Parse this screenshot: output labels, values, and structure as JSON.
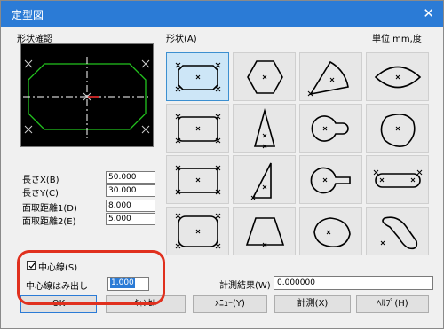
{
  "window": {
    "title": "定型図",
    "close_glyph": "✕"
  },
  "labels": {
    "preview": "形状確認",
    "shape": "形状(A)",
    "units": "単位 mm,度"
  },
  "fields": [
    {
      "label": "長さX(B)",
      "value": "50.000"
    },
    {
      "label": "長さY(C)",
      "value": "30.000"
    },
    {
      "label": "面取距離1(D)",
      "value": "8.000"
    },
    {
      "label": "面取距離2(E)",
      "value": "5.000"
    }
  ],
  "centerline": {
    "checkbox_label": "中心線(S)",
    "checked": true,
    "overhang_label": "中心線はみ出し",
    "overhang_value": "1.000"
  },
  "measure": {
    "label": "計測結果(W)",
    "value": "0.000000"
  },
  "buttons": {
    "ok": "OK",
    "cancel": "ｷｬﾝｾﾙ",
    "menu": "ﾒﾆｭｰ(Y)",
    "measure": "計測(X)",
    "help": "ﾍﾙﾌﾟ(H)"
  },
  "shapes": [
    "chamfered-rectangle",
    "hexagon",
    "sector",
    "lens",
    "rounded-rectangle",
    "isosceles-triangle",
    "circle-with-tab",
    "egg",
    "rectangle",
    "right-triangle",
    "circle-with-stem",
    "slot",
    "rounded-corner-rectangle",
    "trapezoid",
    "teardrop",
    "kidney"
  ],
  "colors": {
    "titlebar": "#2b7bd6",
    "preview_outline": "#22c41e",
    "centerline": "#ffffff",
    "highlight": "#e0301e",
    "selected_cell": "#cde6f7"
  }
}
